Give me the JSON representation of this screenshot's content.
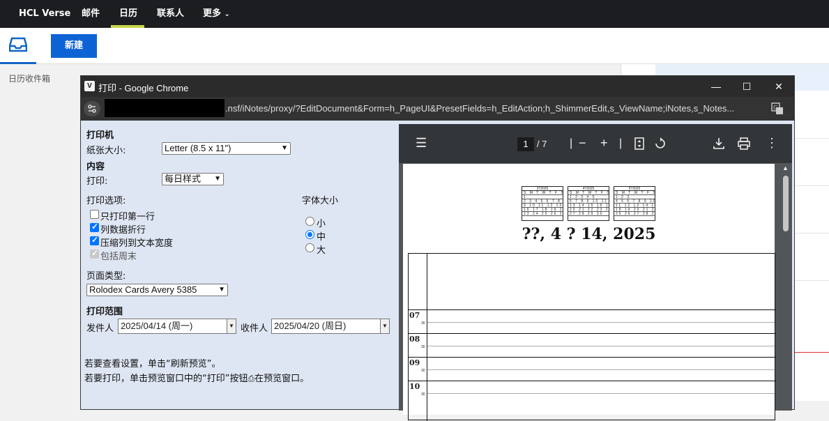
{
  "app": {
    "brand": "HCL Verse",
    "nav": [
      "邮件",
      "日历",
      "联系人",
      "更多"
    ],
    "active_nav": "日历",
    "new_button": "新建",
    "calendar_inbox": "日历收件箱"
  },
  "dialog": {
    "title": "打印 - Google Chrome",
    "url": ".nsf/iNotes/proxy/?EditDocument&Form=h_PageUI&PresetFields=h_EditAction;h_ShimmerEdit,s_ViewName;iNotes,s_Notes...",
    "controls": {
      "minimize": "—",
      "maximize": "☐",
      "close": "✕"
    }
  },
  "form": {
    "printer_heading": "打印机",
    "paper_size_label": "纸张大小:",
    "paper_size_value": "Letter (8.5 x 11\")",
    "content_heading": "内容",
    "print_label": "打印:",
    "print_value": "每日样式",
    "print_options_label": "打印选项:",
    "options": [
      {
        "label": "只打印第一行",
        "checked": false
      },
      {
        "label": "列数据折行",
        "checked": true
      },
      {
        "label": "压缩列到文本宽度",
        "checked": true
      },
      {
        "label": "包括周末",
        "checked": true,
        "disabled": true
      }
    ],
    "font_size_label": "字体大小",
    "font_sizes": [
      {
        "label": "小",
        "selected": false
      },
      {
        "label": "中",
        "selected": true
      },
      {
        "label": "大",
        "selected": false
      }
    ],
    "page_type_label": "页面类型:",
    "page_type_value": "Rolodex Cards Avery 5385",
    "range_heading": "打印范围",
    "from_label": "发件人",
    "from_value": "2025/04/14 (周一)",
    "to_label": "收件人",
    "to_value": "2025/04/20 (周日)",
    "hint1": "若要查看设置，单击“刷新预览”。",
    "hint2": "若要打印，单击预览窗口中的“打印”按钮",
    "hint2_tail": "在预览窗口。"
  },
  "preview": {
    "current_page": "1",
    "of_pages": "/  7",
    "mini_calendars": [
      {
        "title": "3?2025",
        "rows": [
          "S M T W T F S",
          "      1",
          "2 3 4 5 6 7 8",
          "9 10 11 12 13 14 15",
          "16 17 18 19 20 21 22",
          "23 24 25 26 27 28 29",
          "30 31"
        ]
      },
      {
        "title": "4?2025",
        "rows": [
          "S M T W T F S",
          "  1 2 3 4 5",
          "6 7 8 9 10 11 12",
          "13 14 15 16 17 18 19",
          "20 21 22 23 24 25 26",
          "27 28 29 30",
          ""
        ]
      },
      {
        "title": "5?2025",
        "rows": [
          "S M T W T F S",
          "    1 2 3",
          "4 5 6 7 8 9 10",
          "11 12 13 14 15 16 17",
          "18 19 20 21 22 23 24",
          "25 26 27 28 29 30 31",
          ""
        ]
      }
    ],
    "heading": "??, 4 ? 14, 2025",
    "hours": [
      "07",
      "08",
      "09",
      "10"
    ],
    "half_label": "30"
  }
}
